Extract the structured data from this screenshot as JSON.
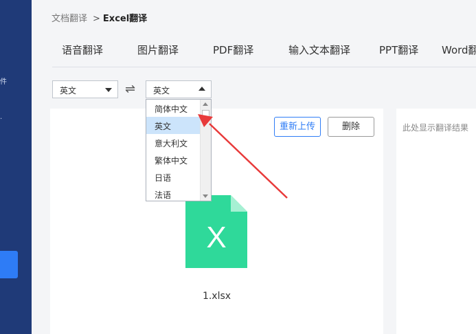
{
  "sidebar": {
    "marks": [
      "件",
      "."
    ]
  },
  "breadcrumb": {
    "parent": "文档翻译",
    "separator": ">",
    "current": "Excel翻译"
  },
  "tabs": [
    "语音翻译",
    "图片翻译",
    "PDF翻译",
    "输入文本翻译",
    "PPT翻译",
    "Word翻"
  ],
  "language": {
    "source": "英文",
    "target": "英文",
    "swap_icon": "⇌",
    "options": [
      "简体中文",
      "英文",
      "意大利文",
      "繁体中文",
      "日语",
      "法语"
    ],
    "selected_option": "英文"
  },
  "left_panel": {
    "reupload_label": "重新上传",
    "delete_label": "删除",
    "file_icon_letter": "X",
    "file_name": "1.xlsx"
  },
  "right_panel": {
    "placeholder": "此处显示翻译结果"
  },
  "colors": {
    "sidebar": "#1f3a78",
    "accent": "#2e7cf6",
    "excel_green": "#2fd99a",
    "arrow_red": "#e83a3a"
  }
}
